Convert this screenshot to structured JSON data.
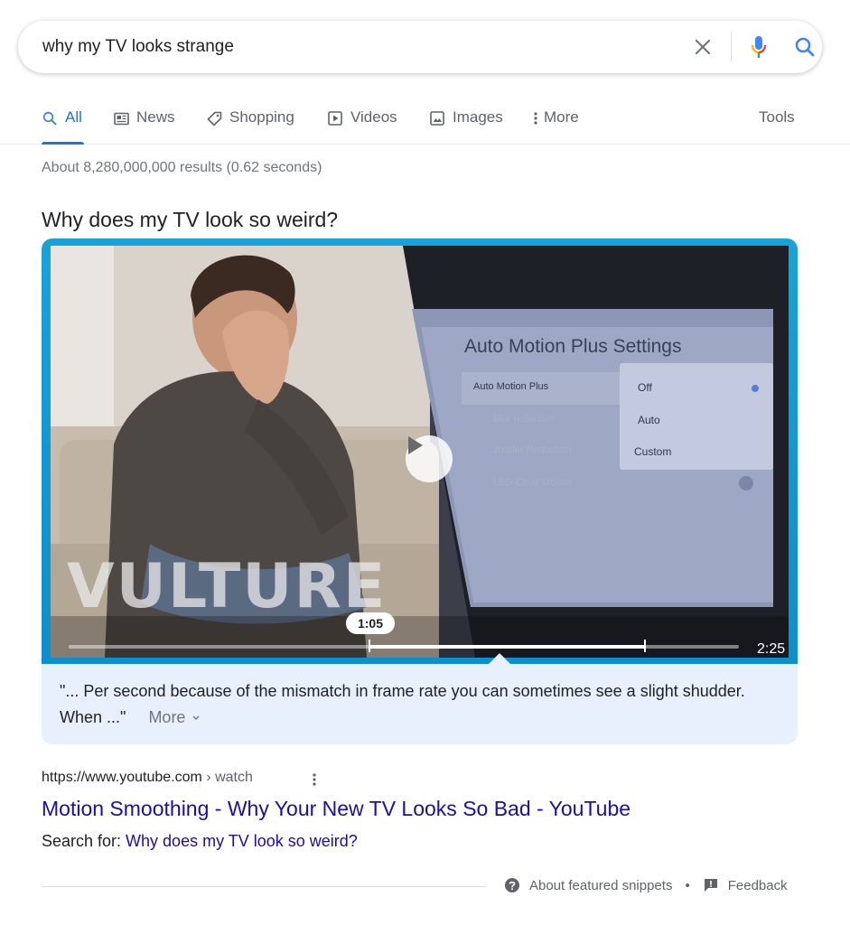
{
  "search": {
    "query": "why my TV looks strange",
    "clear_icon": "close-icon",
    "mic_icon": "mic-icon",
    "search_icon": "search-icon"
  },
  "tabs": [
    {
      "label": "All",
      "icon": "search-icon",
      "active": true
    },
    {
      "label": "News",
      "icon": "news-icon"
    },
    {
      "label": "Shopping",
      "icon": "tag-icon"
    },
    {
      "label": "Videos",
      "icon": "play-icon"
    },
    {
      "label": "Images",
      "icon": "image-icon"
    },
    {
      "label": "More",
      "icon": "more-vert-icon"
    }
  ],
  "tools_label": "Tools",
  "result_stats": "About 8,280,000,000 results (0.62 seconds)",
  "featured_snippet": {
    "question": "Why does my TV look so weird?",
    "video": {
      "brand_watermark": "VULTURE",
      "tv_menu": {
        "title": "Auto Motion Plus Settings",
        "left_item": "Auto Motion Plus",
        "options": [
          "Off",
          "Auto",
          "Custom"
        ],
        "faded_items": [
          "Blur reduction",
          "Judder Reduction",
          "LED Clear Motion"
        ]
      },
      "current_time": "1:05",
      "duration": "2:25",
      "progress_fraction": 0.45,
      "clip_end_fraction": 0.86
    },
    "quote": "\"... Per second because of the mismatch in frame rate you can sometimes see a slight shudder. When ...\"",
    "more_label": "More"
  },
  "result": {
    "url_domain": "https://www.youtube.com",
    "url_path": " › watch",
    "title": "Motion Smoothing - Why Your New TV Looks So Bad - YouTube",
    "search_for_label": "Search for: ",
    "search_for_link": "Why does my TV look so weird?"
  },
  "footer": {
    "about_label": "About featured snippets",
    "separator": "•",
    "feedback_label": "Feedback"
  },
  "colors": {
    "link": "#1a0dab",
    "accent": "#1a73e8",
    "snippet_bg": "#e8f0fe",
    "video_border": "#0c8fcf"
  }
}
